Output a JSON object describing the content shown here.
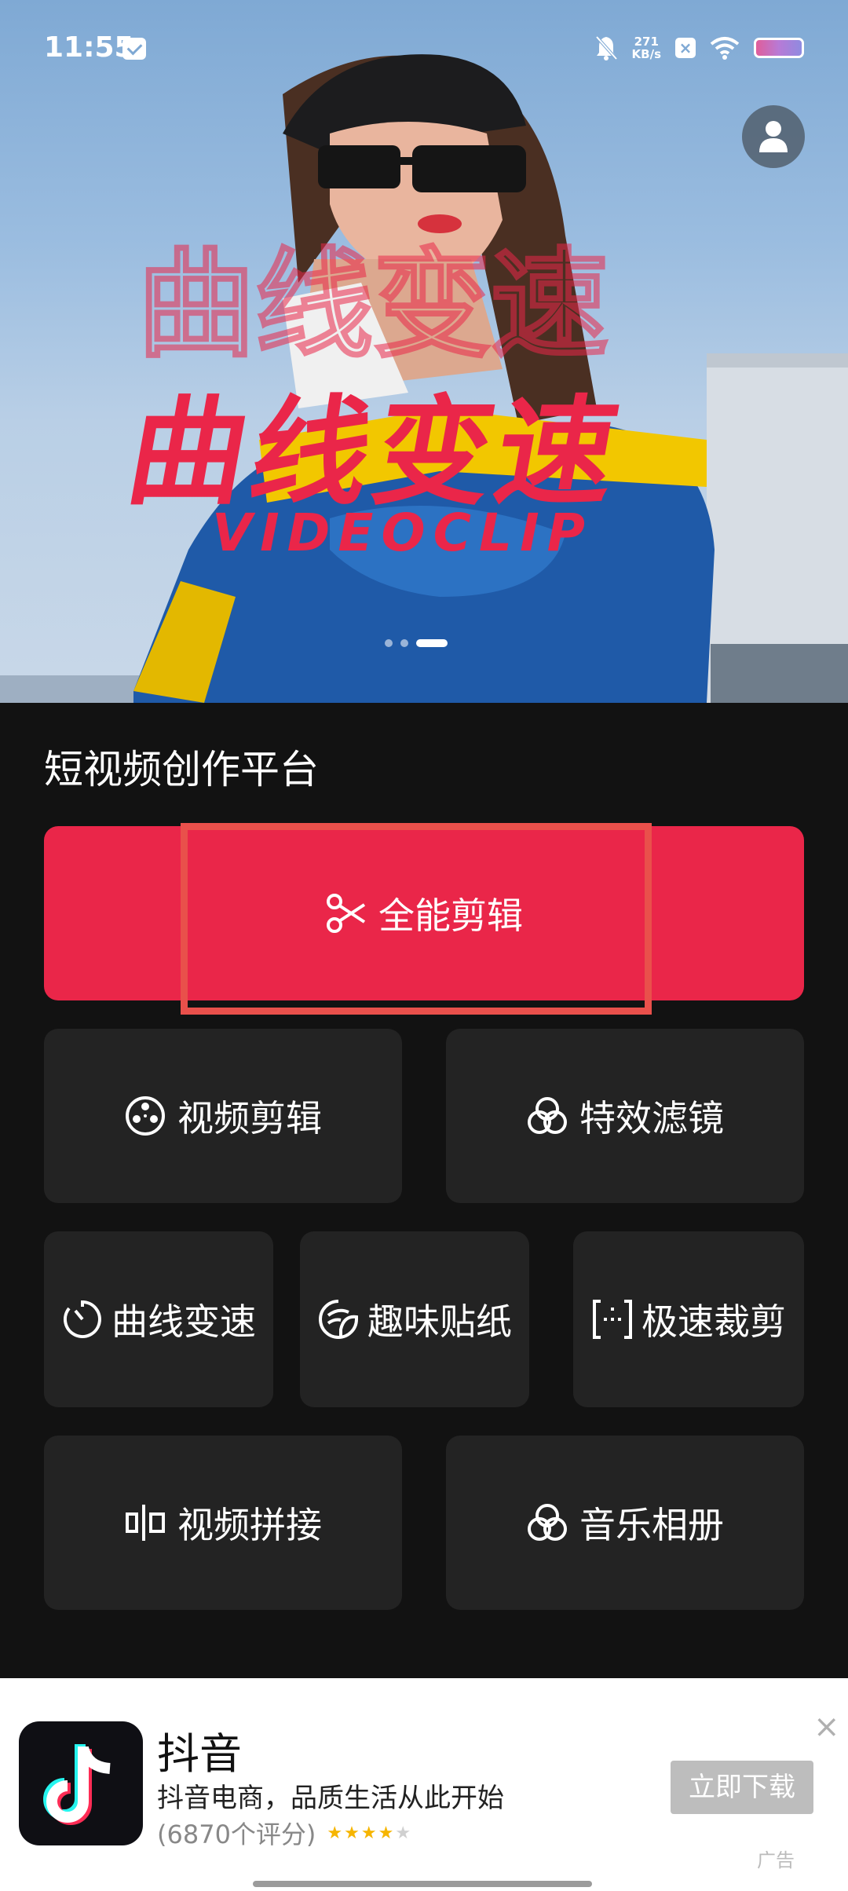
{
  "status_bar": {
    "time": "11:55",
    "network_speed": "271",
    "network_unit": "KB/s"
  },
  "banner": {
    "title": "曲线变速",
    "subtitle": "VIDEOCLIP",
    "carousel_total": 3,
    "carousel_active": 3
  },
  "section": {
    "title": "短视频创作平台"
  },
  "tools": {
    "primary": {
      "label": "全能剪辑",
      "icon": "scissors-icon"
    },
    "video_edit": {
      "label": "视频剪辑",
      "icon": "film-reel-icon"
    },
    "effects_filter": {
      "label": "特效滤镜",
      "icon": "filter-circles-icon"
    },
    "curve_speed": {
      "label": "曲线变速",
      "icon": "timer-icon"
    },
    "stickers": {
      "label": "趣味贴纸",
      "icon": "sticker-icon"
    },
    "quick_crop": {
      "label": "极速裁剪",
      "icon": "crop-frame-icon"
    },
    "video_splice": {
      "label": "视频拼接",
      "icon": "splice-icon"
    },
    "music_album": {
      "label": "音乐相册",
      "icon": "album-circles-icon"
    }
  },
  "ad": {
    "app_name": "抖音",
    "description": "抖音电商，品质生活从此开始",
    "rating_text": "(6870个评分)",
    "stars": 4,
    "button_label": "立即下载",
    "ad_mark": "广告"
  },
  "colors": {
    "accent": "#ea2649",
    "tile": "#232323",
    "background": "#121212"
  }
}
